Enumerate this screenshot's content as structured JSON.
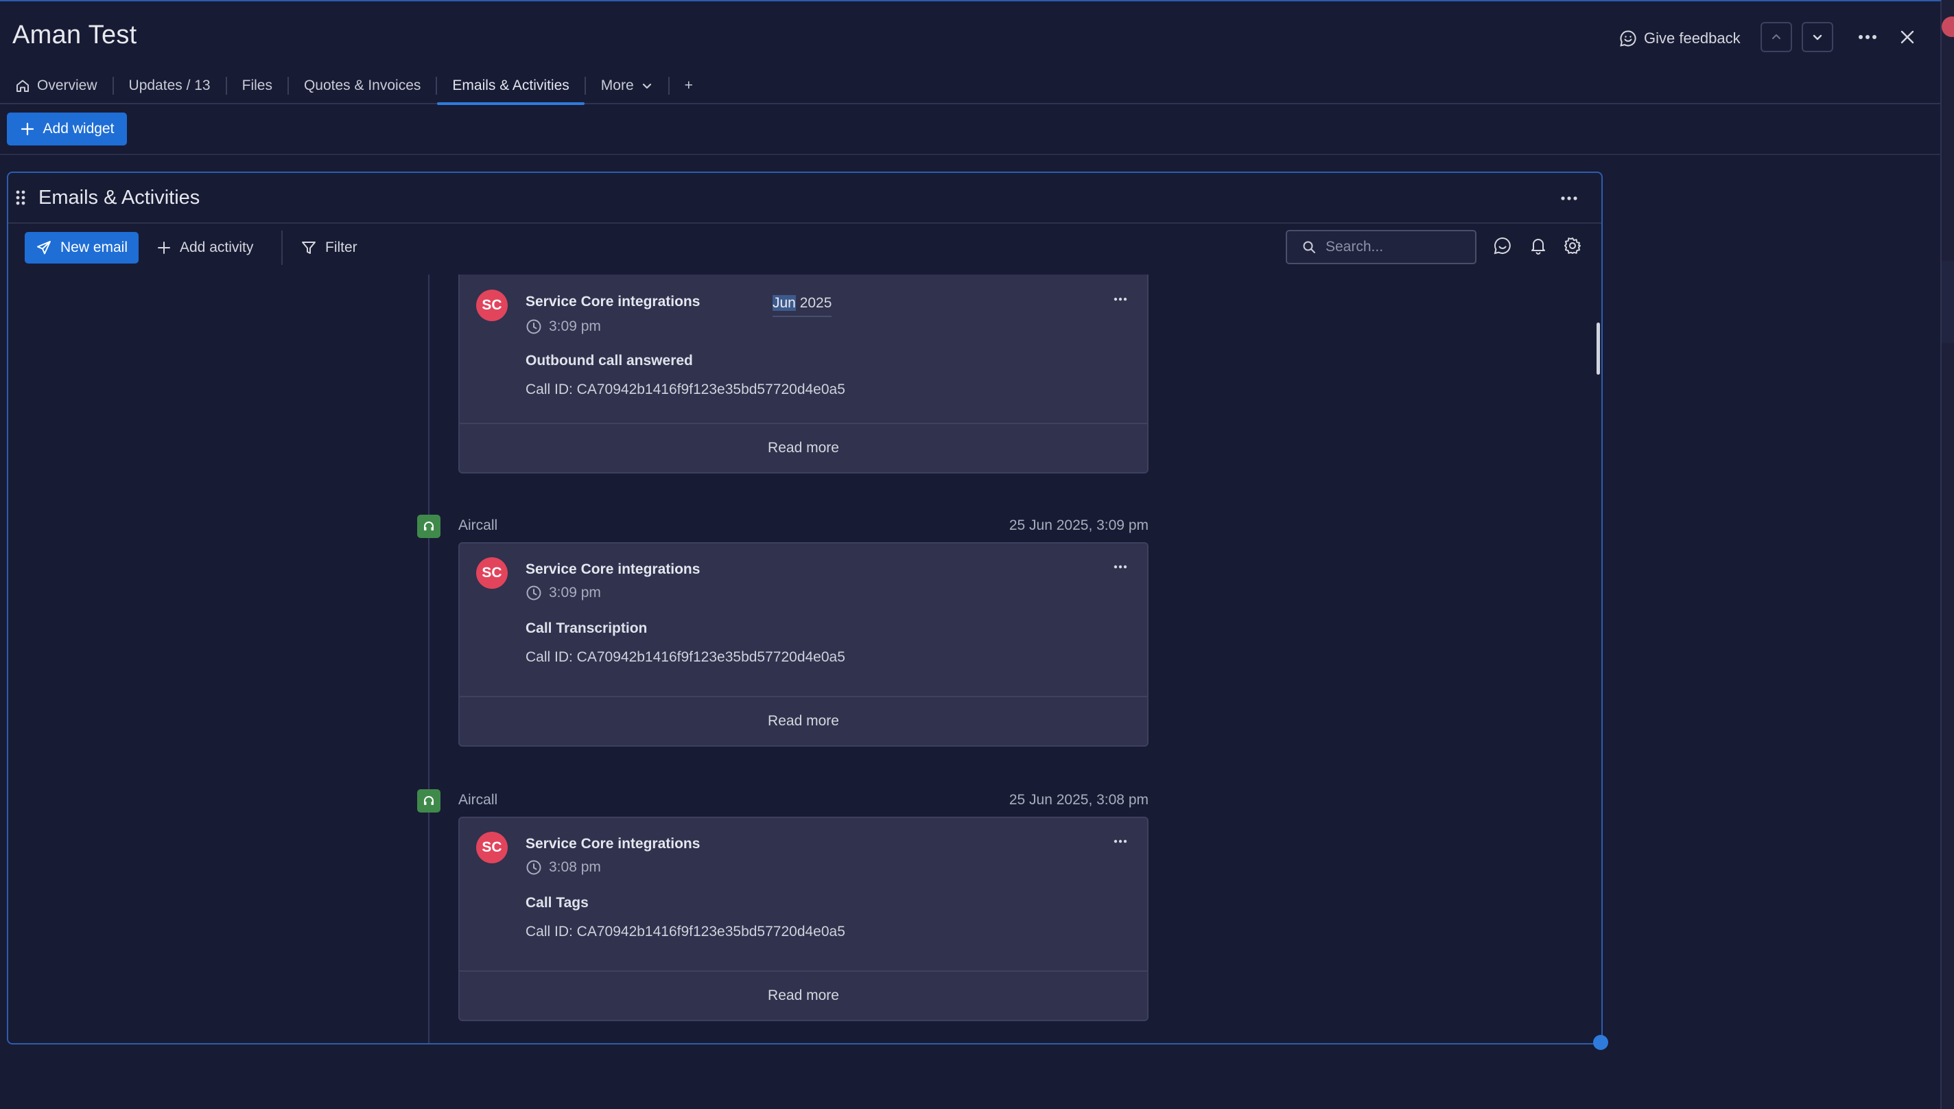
{
  "header": {
    "title": "Aman Test",
    "feedback_label": "Give feedback"
  },
  "tabs": [
    {
      "label": "Overview",
      "icon": "home-icon"
    },
    {
      "label": "Updates / 13"
    },
    {
      "label": "Files"
    },
    {
      "label": "Quotes & Invoices"
    },
    {
      "label": "Emails & Activities",
      "active": true
    },
    {
      "label": "More",
      "icon": "chevron-down-icon"
    },
    {
      "label": "+"
    }
  ],
  "add_widget_label": "Add widget",
  "widget": {
    "title": "Emails & Activities",
    "toolbar": {
      "new_email": "New email",
      "add_activity": "Add activity",
      "filter": "Filter",
      "search_placeholder": "Search..."
    }
  },
  "feed": {
    "date_chip": {
      "highlight": "Jun",
      "rest": " 2025"
    },
    "items": [
      {
        "source": "",
        "date": "",
        "author_initials": "SC",
        "author": "Service Core integrations",
        "time": "3:09 pm",
        "title": "Outbound call answered",
        "call_id": "Call ID: CA70942b1416f9f123e35bd57720d4e0a5",
        "read_more": "Read more"
      },
      {
        "source": "Aircall",
        "date": "25 Jun 2025, 3:09 pm",
        "author_initials": "SC",
        "author": "Service Core integrations",
        "time": "3:09 pm",
        "title": "Call Transcription",
        "call_id": "Call ID: CA70942b1416f9f123e35bd57720d4e0a5",
        "read_more": "Read more"
      },
      {
        "source": "Aircall",
        "date": "25 Jun 2025, 3:08 pm",
        "author_initials": "SC",
        "author": "Service Core integrations",
        "time": "3:08 pm",
        "title": "Call Tags",
        "call_id": "Call ID: CA70942b1416f9f123e35bd57720d4e0a5",
        "read_more": "Read more"
      }
    ]
  },
  "colors": {
    "background": "#181b34",
    "accent": "#1f6ed6",
    "avatar": "#e2445c",
    "aircall_green": "#3f8a4b",
    "card": "#30324e"
  }
}
